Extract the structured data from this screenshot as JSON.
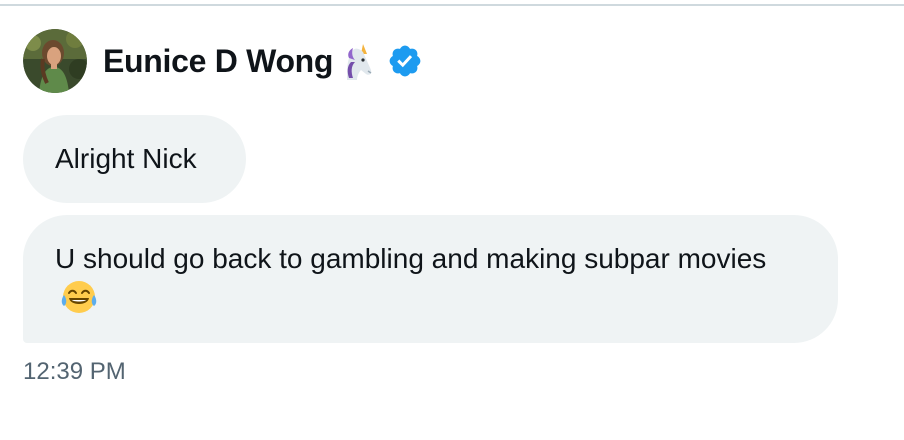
{
  "sender": {
    "display_name": "Eunice D Wong",
    "name_emoji": "unicorn-icon",
    "verified": true,
    "verified_color": "#1d9bf0"
  },
  "messages": [
    {
      "text": "Alright Nick"
    },
    {
      "text": "U should go back to gambling and making subpar movies",
      "trailing_emoji": "face-with-tears-of-joy-icon"
    }
  ],
  "timestamp": "12:39 PM",
  "colors": {
    "bubble_background": "#eff3f4",
    "text": "#0f1419",
    "secondary_text": "#536471"
  }
}
